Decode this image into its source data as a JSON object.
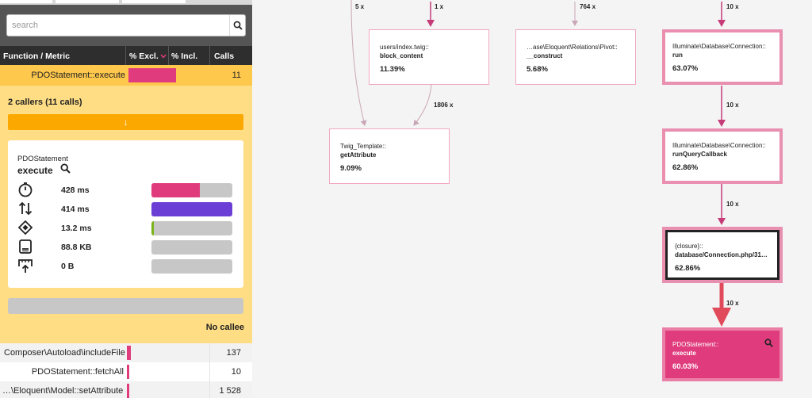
{
  "sidebar": {
    "search": {
      "placeholder": "search"
    },
    "columns": {
      "function": "Function / Metric",
      "excl": "% Excl.",
      "incl": "% Incl.",
      "calls": "Calls"
    },
    "selected": {
      "function": "PDOStatement::execute",
      "calls": "11"
    },
    "callers": {
      "title": "2 callers (11 calls)",
      "expand_arrow": "↓"
    },
    "detail": {
      "class": "PDOStatement",
      "method": "execute",
      "metrics": [
        {
          "icon": "clock-icon",
          "value": "428 ms",
          "fill": 0.6,
          "color": "#e03c7d"
        },
        {
          "icon": "io-arrows-icon",
          "value": "414 ms",
          "fill": 1.0,
          "color": "#6b3fd6"
        },
        {
          "icon": "cpu-icon",
          "value": "13.2 ms",
          "fill": 0.03,
          "color": "#7ab317"
        },
        {
          "icon": "memory-icon",
          "value": "88.8 KB",
          "fill": 0.0,
          "color": "#c7c7c7"
        },
        {
          "icon": "network-icon",
          "value": "0 B",
          "fill": 0.0,
          "color": "#c7c7c7"
        }
      ]
    },
    "no_callee": "No callee",
    "list": [
      {
        "function": "Composer\\Autoload\\includeFile",
        "calls": "137"
      },
      {
        "function": "PDOStatement::fetchAll",
        "calls": "10"
      },
      {
        "function": "…\\Eloquent\\Model::setAttribute",
        "calls": "1 528"
      }
    ]
  },
  "graph": {
    "nodes": [
      {
        "line1": "users/index.twig::",
        "line2": "block_content",
        "pct": "11.39%"
      },
      {
        "line1": "…ase\\Eloquent\\Relations\\Pivot::",
        "line2": "__construct",
        "pct": "5.68%"
      },
      {
        "line1": "Illuminate\\Database\\Connection::",
        "line2": "run",
        "pct": "63.07%"
      },
      {
        "line1": "Twig_Template::",
        "line2": "getAttribute",
        "pct": "9.09%"
      },
      {
        "line1": "Illuminate\\Database\\Connection::",
        "line2": "runQueryCallback",
        "pct": "62.86%"
      },
      {
        "line1": "{closure}::",
        "line2": "database/Connection.php/31…",
        "pct": "62.86%"
      },
      {
        "line1": "PDOStatement::",
        "line2": "execute",
        "pct": "60.03%"
      }
    ],
    "edges": [
      "5 x",
      "1 x",
      "764 x",
      "10 x",
      "1806 x",
      "10 x",
      "10 x",
      "10 x"
    ]
  },
  "colors": {
    "accent": "#e03c7d",
    "selected_row": "#fec84d",
    "panel": "#fedd85",
    "button": "#fba800",
    "io": "#6b3fd6",
    "cpu": "#7ab317"
  }
}
